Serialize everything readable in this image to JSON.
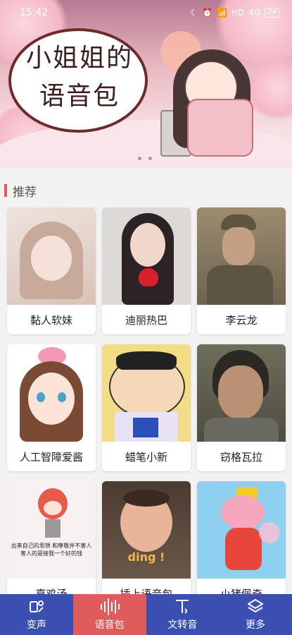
{
  "status_bar": {
    "time": "15:42",
    "network": "HD",
    "signal": "4G",
    "battery": "24"
  },
  "banner": {
    "bubble_line1": "小姐姐的",
    "bubble_line2": "语音包",
    "page_dots": 2
  },
  "section": {
    "title": "推荐"
  },
  "cards": [
    {
      "name": "黏人软妹",
      "bg": "#e8d7cf",
      "accent": "#c9a89a"
    },
    {
      "name": "迪丽热巴",
      "bg": "#d9d6d3",
      "accent": "#2b2326"
    },
    {
      "name": "李云龙",
      "bg": "#8a7a5d",
      "accent": "#5f553e"
    },
    {
      "name": "人工智障爱酱",
      "bg": "#ffffff",
      "accent": "#f0a8c0"
    },
    {
      "name": "蜡笔小新",
      "bg": "#f6d86a",
      "accent": "#3a3a3a"
    },
    {
      "name": "窃格瓦拉",
      "bg": "#6b6a58",
      "accent": "#3e3a2e"
    },
    {
      "name": "嘉鸡汤",
      "bg": "#f7f1f1",
      "accent": "#e85a4a",
      "caption": "出来自己的思想 和尊敬并不害人 害人的是接我一个好的钱"
    },
    {
      "name": "插上语音包",
      "bg": "#5d4a3e",
      "accent": "#e8b49a",
      "caption": "ding !"
    },
    {
      "name": "小猪佩奇",
      "bg": "#8fd0f0",
      "accent": "#f6a6bd"
    }
  ],
  "nav": [
    {
      "label": "变声",
      "icon": "voice-change-icon"
    },
    {
      "label": "语音包",
      "icon": "waveform-icon",
      "active": true
    },
    {
      "label": "文转音",
      "icon": "text-to-speech-icon"
    },
    {
      "label": "更多",
      "icon": "layers-icon"
    }
  ],
  "colors": {
    "nav": "#3b4fb3",
    "active": "#e05b5b",
    "accent": "#e05a5a"
  }
}
